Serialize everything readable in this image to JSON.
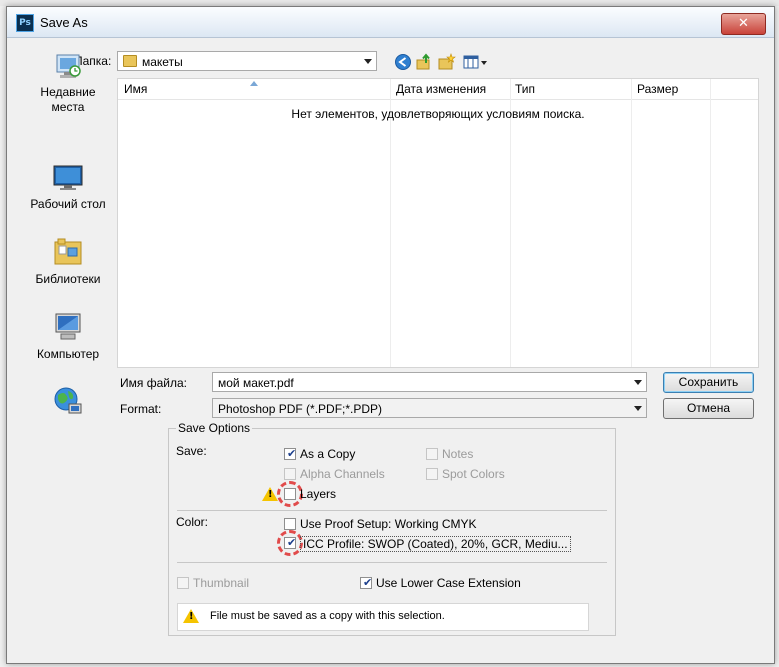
{
  "window": {
    "title": "Save As",
    "app_icon": "Ps",
    "close_label": "✕"
  },
  "folder_bar": {
    "label": "Папка:",
    "current": "макеты"
  },
  "places": [
    {
      "name": "recent-places",
      "label_lines": [
        "Недавние",
        "места"
      ],
      "icon": "recent-places-icon"
    },
    {
      "name": "desktop",
      "label_lines": [
        "Рабочий стол"
      ],
      "icon": "desktop-icon"
    },
    {
      "name": "libraries",
      "label_lines": [
        "Библиотеки"
      ],
      "icon": "libraries-icon"
    },
    {
      "name": "computer",
      "label_lines": [
        "Компьютер"
      ],
      "icon": "computer-icon"
    },
    {
      "name": "network",
      "label_lines": [],
      "icon": "network-icon"
    }
  ],
  "file_list": {
    "columns": [
      "Имя",
      "Дата изменения",
      "Тип",
      "Размер"
    ],
    "empty_message": "Нет элементов, удовлетворяющих условиям поиска."
  },
  "filename": {
    "label": "Имя файла:",
    "value": "мой макет.pdf"
  },
  "format": {
    "label": "Format:",
    "value": "Photoshop PDF (*.PDF;*.PDP)"
  },
  "buttons": {
    "save": "Сохранить",
    "cancel": "Отмена"
  },
  "save_options": {
    "title": "Save Options",
    "save_label": "Save:",
    "as_copy": {
      "label": "As a Copy",
      "checked": true
    },
    "alpha_channels": {
      "label": "Alpha Channels",
      "checked": false
    },
    "layers": {
      "label": "Layers",
      "checked": false
    },
    "notes": {
      "label": "Notes",
      "checked": false
    },
    "spot_colors": {
      "label": "Spot Colors",
      "checked": false
    },
    "color_label": "Color:",
    "use_proof": {
      "label": "Use Proof Setup:  Working CMYK",
      "checked": false
    },
    "icc_profile": {
      "label": "ICC Profile:  SWOP (Coated), 20%, GCR, Mediu...",
      "checked": true
    },
    "thumbnail": {
      "label": "Thumbnail",
      "checked": false
    },
    "lower_case": {
      "label": "Use Lower Case Extension",
      "checked": true
    },
    "warning": "File must be saved as a copy with this selection."
  },
  "colors": {
    "accent": "#3c7fb1",
    "highlight": "#e14b4b",
    "warning": "#f5c400"
  }
}
